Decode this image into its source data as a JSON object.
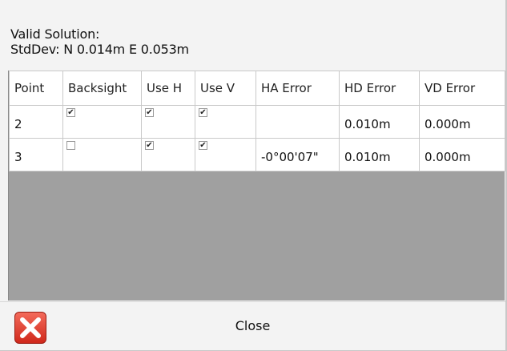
{
  "summary": {
    "line1": "Valid Solution:",
    "line2": "StdDev: N 0.014m E 0.053m"
  },
  "table": {
    "headers": [
      "Point",
      "Backsight",
      "Use H",
      "Use V",
      "HA Error",
      "HD Error",
      "VD Error"
    ],
    "rows": [
      {
        "point": "2",
        "backsight": true,
        "use_h": true,
        "use_v": true,
        "ha_error": "",
        "hd_error": "0.010m",
        "vd_error": "0.000m"
      },
      {
        "point": "3",
        "backsight": false,
        "use_h": true,
        "use_v": true,
        "ha_error": "-0°00'07\"",
        "hd_error": "0.010m",
        "vd_error": "0.000m"
      }
    ]
  },
  "footer": {
    "close_label": "Close",
    "close_icon": "close-x-icon"
  },
  "colors": {
    "panel_bg": "#f3f3f3",
    "grid_bg": "#a0a0a0",
    "close_red": "#d0281b"
  }
}
